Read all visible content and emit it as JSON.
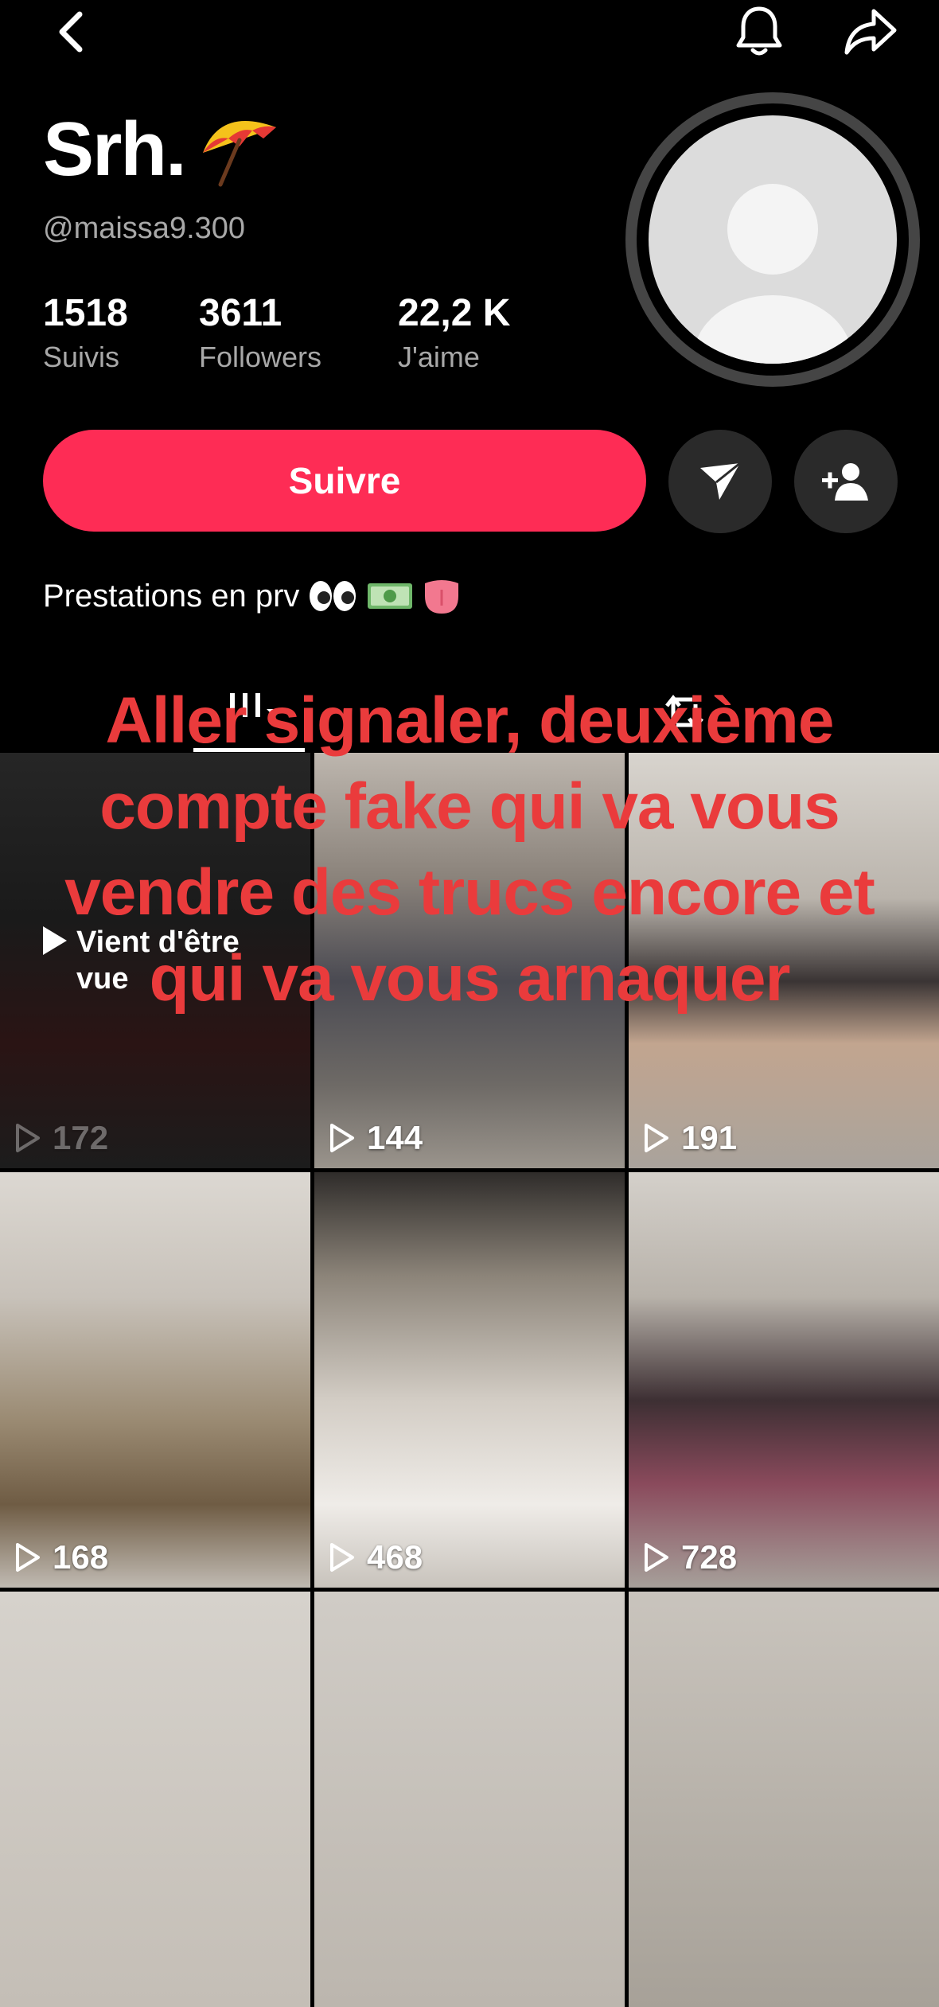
{
  "profile": {
    "display_name": "Srh.",
    "handle": "@maissa9.300",
    "bio": "Prestations en prv"
  },
  "stats": [
    {
      "value": "1518",
      "label": "Suivis"
    },
    {
      "value": "3611",
      "label": "Followers"
    },
    {
      "value": "22,2 K",
      "label": "J'aime"
    }
  ],
  "actions": {
    "follow_label": "Suivre"
  },
  "videos": [
    {
      "views": "172",
      "badge_line1": "Vient d'être",
      "badge_line2": "vue"
    },
    {
      "views": "144"
    },
    {
      "views": "191"
    },
    {
      "views": "168"
    },
    {
      "views": "468"
    },
    {
      "views": "728"
    }
  ],
  "overlay_text": "Aller signaler, deuxième compte fake qui va vous vendre des trucs encore et qui va vous arnaquer",
  "icons": {
    "back": "chevron-left-icon",
    "notifications": "bell-icon",
    "share": "share-arrow-icon",
    "message": "send-icon",
    "add_friend": "add-user-icon",
    "videos_tab": "grid-icon",
    "reposts_tab": "repost-icon",
    "play": "play-icon"
  },
  "colors": {
    "accent": "#fe2c55",
    "overlay": "#ea3b3c",
    "background": "#000000"
  }
}
